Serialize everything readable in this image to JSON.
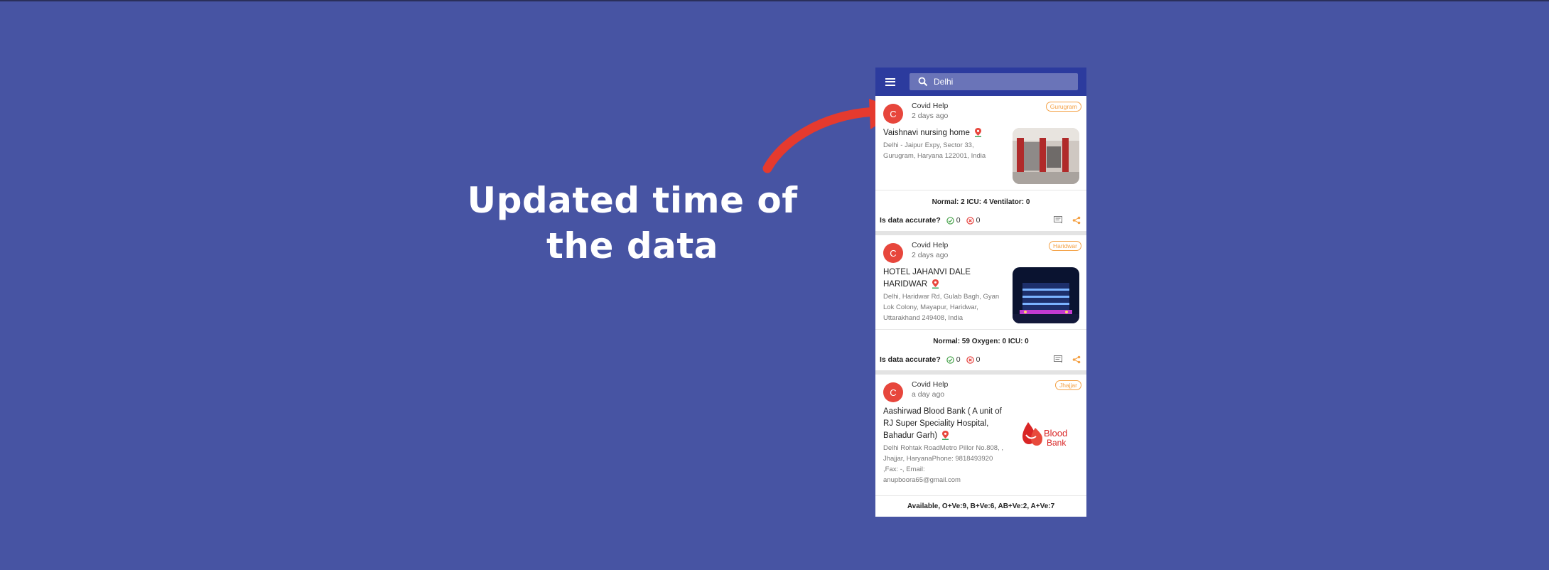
{
  "caption": {
    "line1": "Updated time of",
    "line2": "the data"
  },
  "colors": {
    "background": "#4754a3",
    "appbar": "#2c3b9e",
    "arrow": "#e53a2e",
    "tag": "#f4a145",
    "avatar": "#e7463c"
  },
  "search": {
    "icon": "search-icon",
    "value": "Delhi"
  },
  "menu": {
    "icon": "menu-icon"
  },
  "cards": [
    {
      "avatar": "C",
      "poster": "Covid Help",
      "time": "2 days ago",
      "tag": "Gurugram",
      "title_lines": [
        "Vaishnavi nursing home"
      ],
      "address_lines": [
        "Delhi - Jaipur Expy, Sector 33,",
        "Gurugram, Haryana 122001, India"
      ],
      "stats": "Normal: 2 ICU: 4 Ventilator: 0",
      "accuracy_label": "Is data accurate?",
      "yes_votes": "0",
      "no_votes": "0"
    },
    {
      "avatar": "C",
      "poster": "Covid Help",
      "time": "2 days ago",
      "tag": "Haridwar",
      "title_lines": [
        "HOTEL JAHANVI DALE",
        "HARIDWAR"
      ],
      "address_lines": [
        "Delhi, Haridwar Rd, Gulab Bagh, Gyan",
        "Lok Colony, Mayapur, Haridwar,",
        "Uttarakhand 249408, India"
      ],
      "stats": "Normal: 59 Oxygen: 0 ICU: 0",
      "accuracy_label": "Is data accurate?",
      "yes_votes": "0",
      "no_votes": "0"
    },
    {
      "avatar": "C",
      "poster": "Covid Help",
      "time": "a day ago",
      "tag": "Jhajjar",
      "title_lines": [
        "Aashirwad Blood Bank ( A unit of",
        "RJ Super Speciality Hospital,",
        "Bahadur Garh)"
      ],
      "address_lines": [
        "Delhi Rohtak RoadMetro Pillor No.808, ,",
        "Jhajjar, HaryanaPhone: 9818493920",
        ",Fax: -, Email:",
        "anupboora65@gmail.com"
      ],
      "stats": "Available, O+Ve:9, B+Ve:6, AB+Ve:2, A+Ve:7",
      "logo_text_1": "Blood",
      "logo_text_2": "Bank"
    }
  ]
}
